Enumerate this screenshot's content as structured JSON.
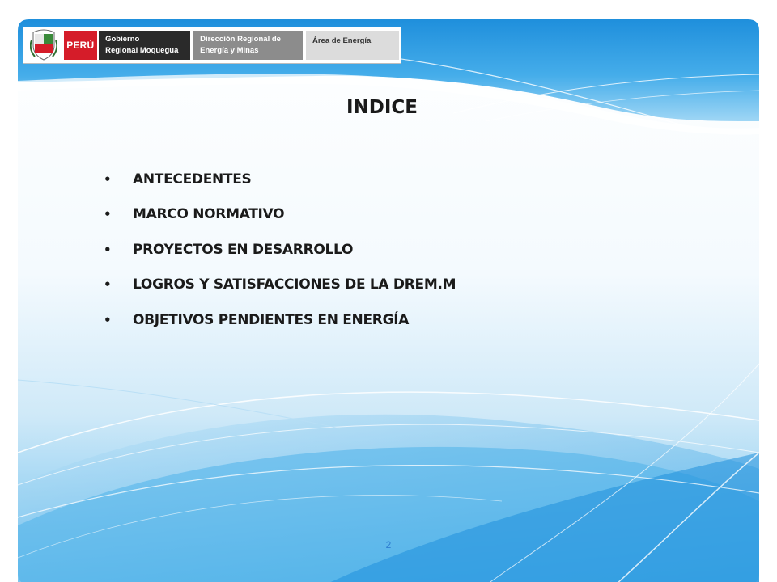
{
  "header": {
    "peru_label": "PERÚ",
    "government": [
      "Gobierno",
      "Regional Moquegua"
    ],
    "direction": [
      "Dirección Regional de",
      "Energía y Minas"
    ],
    "area": "Área de Energía"
  },
  "title": "INDICE",
  "items": [
    "ANTECEDENTES",
    "MARCO NORMATIVO",
    "PROYECTOS EN DESARROLLO",
    "LOGROS Y SATISFACCIONES DE LA DREM.M",
    "OBJETIVOS PENDIENTES EN ENERGÍA"
  ],
  "bullet_symbol": "•",
  "page_number": "2",
  "colors": {
    "accent_blue": "#2e9ae0",
    "peru_red": "#d51c29",
    "text": "#1a1a1a"
  },
  "icons": {
    "shield": "coat-of-arms-icon"
  }
}
